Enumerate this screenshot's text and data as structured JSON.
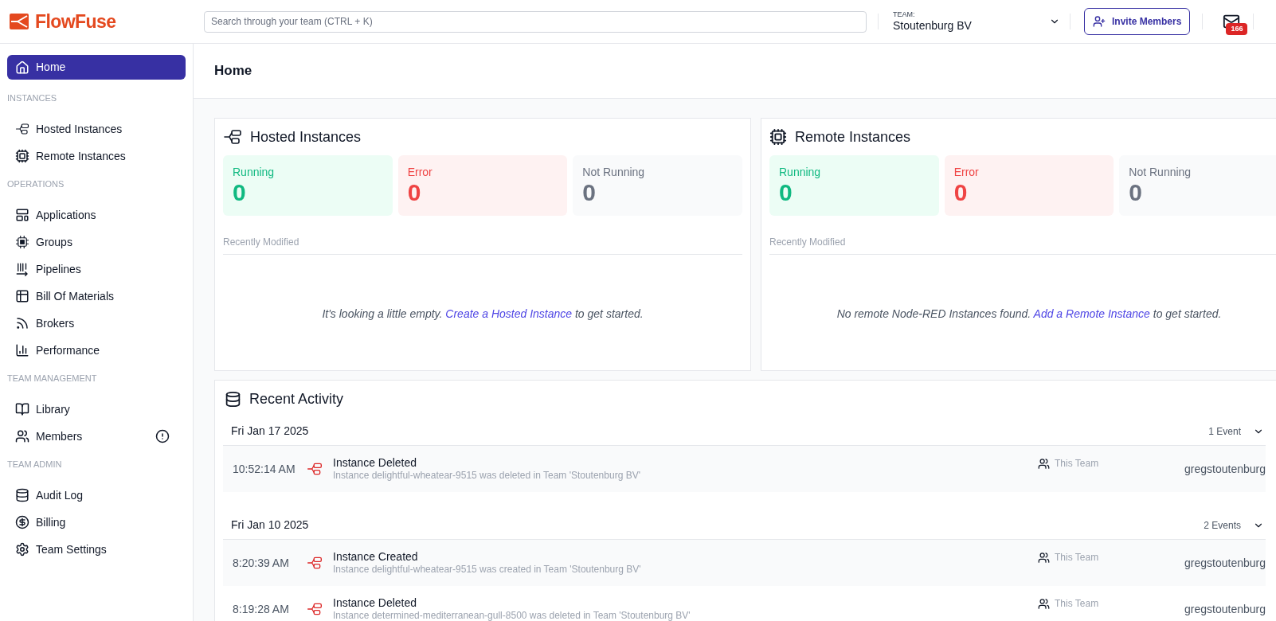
{
  "header": {
    "logo": "FlowFuse",
    "search": {
      "placeholder": "Search through your team (CTRL + K)"
    },
    "team": {
      "label": "TEAM:",
      "name": "Stoutenburg BV"
    },
    "invite_button": "Invite Members",
    "notifications_badge": "166"
  },
  "sidebar": {
    "sections": [
      {
        "items": [
          {
            "label": "Home",
            "selected": true,
            "warning": false
          }
        ]
      },
      {
        "title": "INSTANCES",
        "items": [
          {
            "label": "Hosted Instances",
            "selected": false,
            "warning": false
          },
          {
            "label": "Remote Instances",
            "selected": false,
            "warning": false
          }
        ]
      },
      {
        "title": "OPERATIONS",
        "items": [
          {
            "label": "Applications",
            "selected": false,
            "warning": false
          },
          {
            "label": "Groups",
            "selected": false,
            "warning": false
          },
          {
            "label": "Pipelines",
            "selected": false,
            "warning": false
          },
          {
            "label": "Bill Of Materials",
            "selected": false,
            "warning": false
          },
          {
            "label": "Brokers",
            "selected": false,
            "warning": false
          },
          {
            "label": "Performance",
            "selected": false,
            "warning": false
          }
        ]
      },
      {
        "title": "TEAM MANAGEMENT",
        "items": [
          {
            "label": "Library",
            "selected": false,
            "warning": false
          },
          {
            "label": "Members",
            "selected": false,
            "warning": true
          }
        ]
      },
      {
        "title": "TEAM ADMIN",
        "items": [
          {
            "label": "Audit Log",
            "selected": false,
            "warning": false
          },
          {
            "label": "Billing",
            "selected": false,
            "warning": false
          },
          {
            "label": "Team Settings",
            "selected": false,
            "warning": false
          }
        ]
      }
    ]
  },
  "page_title": "Home",
  "instance_cards": [
    {
      "kind": "hosted",
      "title": "Hosted Instances",
      "stats": [
        {
          "kind": "running",
          "label": "Running",
          "value": "0"
        },
        {
          "kind": "error",
          "label": "Error",
          "value": "0"
        },
        {
          "kind": "not_running",
          "label": "Not Running",
          "value": "0"
        }
      ],
      "recent_label": "Recently Modified",
      "empty": {
        "before": "It's looking a little empty. ",
        "link": "Create a Hosted Instance",
        "after": " to get started."
      }
    },
    {
      "kind": "remote",
      "title": "Remote Instances",
      "stats": [
        {
          "kind": "running",
          "label": "Running",
          "value": "0"
        },
        {
          "kind": "error",
          "label": "Error",
          "value": "0"
        },
        {
          "kind": "not_running",
          "label": "Not Running",
          "value": "0"
        }
      ],
      "recent_label": "Recently Modified",
      "empty": {
        "before": "No remote Node-RED Instances found. ",
        "link": "Add a Remote Instance",
        "after": " to get started."
      }
    }
  ],
  "activity": {
    "title": "Recent Activity",
    "groups": [
      {
        "date": "Fri Jan 17 2025",
        "count": "1 Event",
        "expanded": true,
        "events": [
          {
            "time": "10:52:14 AM",
            "title": "Instance Deleted",
            "description": "Instance delightful-wheatear-9515 was deleted in Team 'Stoutenburg BV'",
            "scope": "This Team",
            "user": "gregstoutenburg"
          }
        ]
      },
      {
        "date": "Fri Jan 10 2025",
        "count": "2 Events",
        "expanded": true,
        "events": [
          {
            "time": "8:20:39 AM",
            "title": "Instance Created",
            "description": "Instance delightful-wheatear-9515 was created in Team 'Stoutenburg BV'",
            "scope": "This Team",
            "user": "gregstoutenburg"
          },
          {
            "time": "8:19:28 AM",
            "title": "Instance Deleted",
            "description": "Instance determined-mediterranean-gull-8500 was deleted in Team 'Stoutenburg BV'",
            "scope": "This Team",
            "user": "gregstoutenburg"
          }
        ]
      }
    ]
  }
}
